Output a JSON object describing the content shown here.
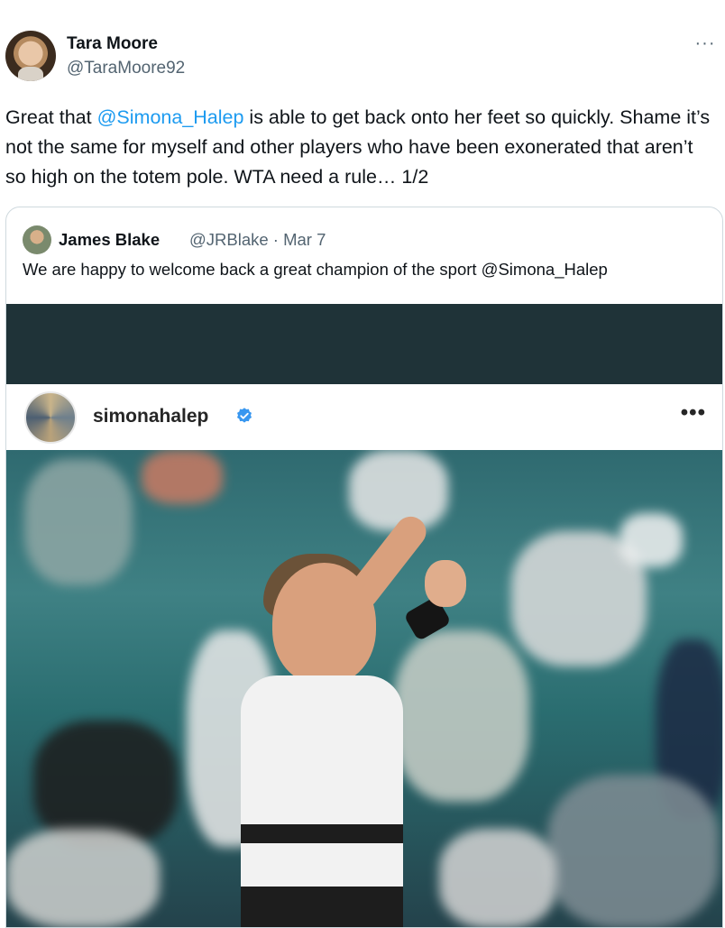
{
  "tweet": {
    "author_name": "Tara Moore",
    "author_handle": "@TaraMoore92",
    "more_label": "···",
    "text_before": "Great that ",
    "mention": "@Simona_Halep",
    "text_after": " is able to get back onto her feet so quickly. Shame it’s not the same for myself and other players who have been exonerated that aren’t so high on the totem pole. WTA need a rule… 1/2"
  },
  "quote": {
    "author_name": "James Blake",
    "handle_date": "@JRBlake · Mar 7",
    "text": "We are happy to welcome back a great champion of the sport @Simona_Halep"
  },
  "media": {
    "ig_username": "simonahalep",
    "ig_more_label": "•••",
    "verified_color": "#3897f0",
    "topbar_color": "#1f3338"
  }
}
